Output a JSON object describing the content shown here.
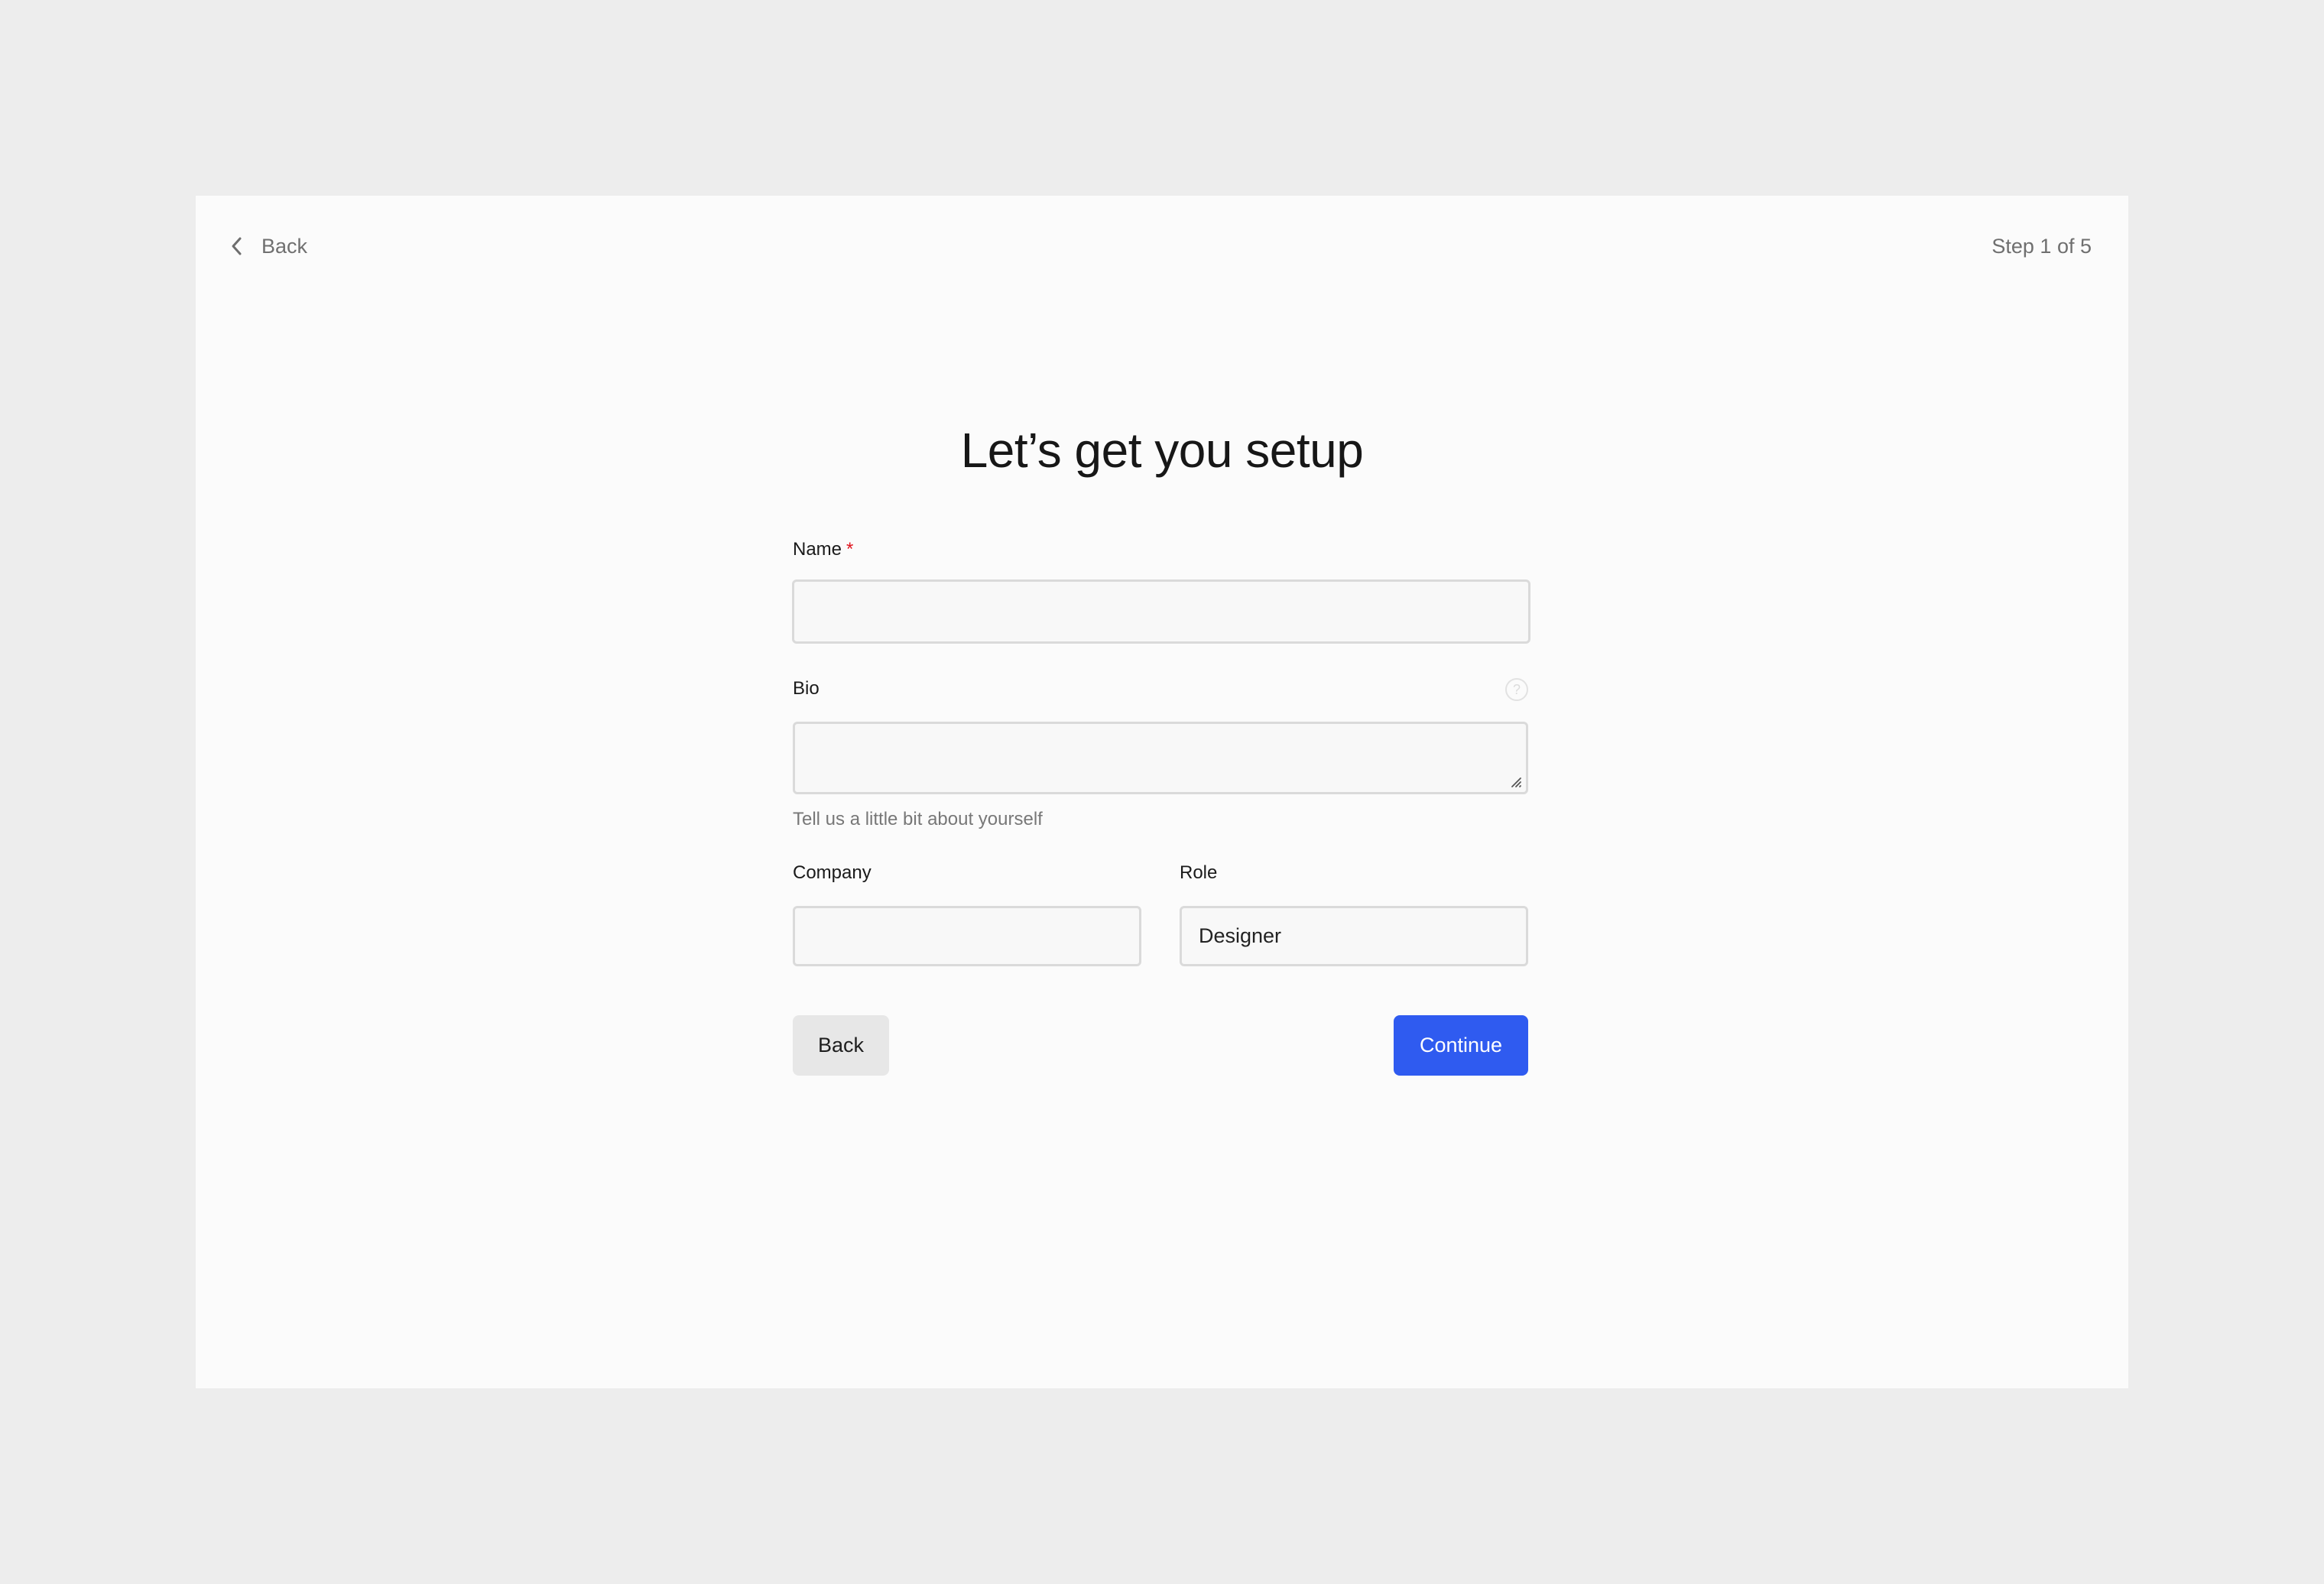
{
  "header": {
    "back_label": "Back",
    "back_icon": "chevron-left-icon",
    "step_text": "Step 1 of 5"
  },
  "title": "Let’s get you setup",
  "form": {
    "name": {
      "label": "Name",
      "required_marker": "*",
      "value": "",
      "placeholder": ""
    },
    "bio": {
      "label": "Bio",
      "help_icon": "question-circle-icon",
      "help_glyph": "?",
      "value": "",
      "placeholder": "",
      "hint": "Tell us a little bit about yourself"
    },
    "company": {
      "label": "Company",
      "value": "",
      "placeholder": ""
    },
    "role": {
      "label": "Role",
      "value": "Designer",
      "placeholder": ""
    }
  },
  "actions": {
    "back_label": "Back",
    "continue_label": "Continue"
  },
  "colors": {
    "primary": "#2f5bf0",
    "required": "#e0141e",
    "page_background": "#ededed",
    "card_background": "#fbfbfb"
  }
}
